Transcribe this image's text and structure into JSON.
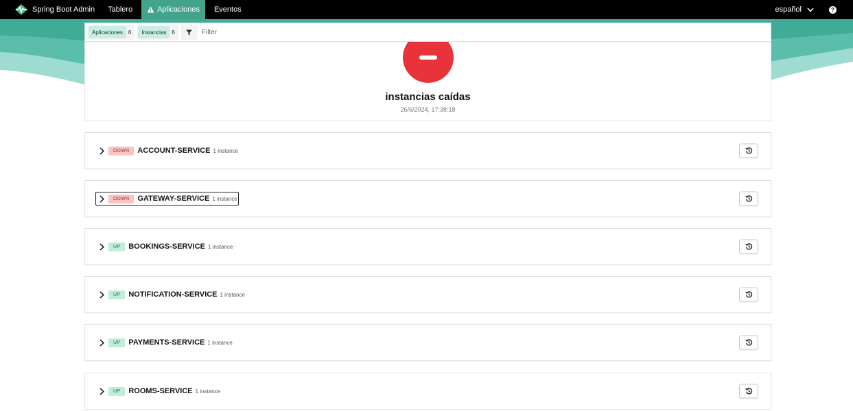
{
  "navbar": {
    "brand": "Spring Boot Admin",
    "items": [
      {
        "label": "Tablero"
      },
      {
        "label": "Aplicaciones"
      },
      {
        "label": "Eventos"
      }
    ],
    "language": "español",
    "help_icon": "question-circle-icon"
  },
  "filter": {
    "applications_label": "Aplicaciones",
    "applications_count": "6",
    "instances_label": "Instancias",
    "instances_count": "6",
    "placeholder": "Filter"
  },
  "status": {
    "title": "instancias caídas",
    "timestamp": "26/6/2024, 17:38:18",
    "color": "#e8333b"
  },
  "applications": [
    {
      "status": "DOWN",
      "name": "ACCOUNT-SERVICE",
      "instances": "1 instance"
    },
    {
      "status": "DOWN",
      "name": "GATEWAY-SERVICE",
      "instances": "1 instance"
    },
    {
      "status": "UP",
      "name": "BOOKINGS-SERVICE",
      "instances": "1 instance"
    },
    {
      "status": "UP",
      "name": "NOTIFICATION-SERVICE",
      "instances": "1 instance"
    },
    {
      "status": "UP",
      "name": "PAYMENTS-SERVICE",
      "instances": "1 instance"
    },
    {
      "status": "UP",
      "name": "ROOMS-SERVICE",
      "instances": "1 instance"
    }
  ],
  "colors": {
    "accent": "#42a48a",
    "down_badge": "#f6c4c4",
    "up_badge": "#bfeed8"
  }
}
